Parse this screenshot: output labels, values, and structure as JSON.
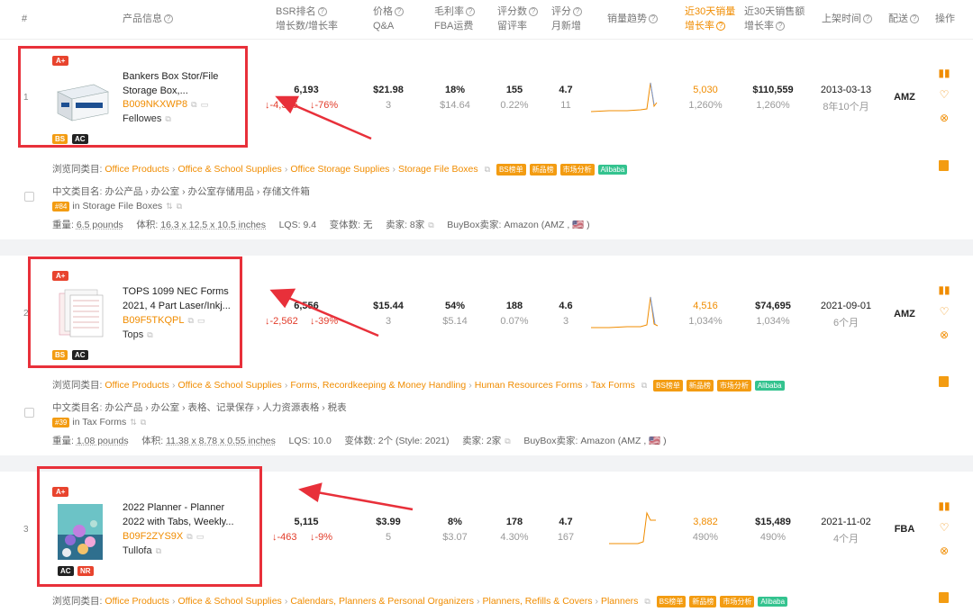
{
  "header": {
    "index": "#",
    "product_info": "产品信息",
    "bsr_rank": "BSR排名",
    "bsr_growth": "增长数/增长率",
    "price": "价格",
    "qa": "Q&A",
    "margin": "毛利率",
    "fba_fee": "FBA运费",
    "rating_count": "评分数",
    "review_rate": "留评率",
    "rating": "评分",
    "monthly_new": "月新增",
    "sales_trend": "销量趋势",
    "sales30": "近30天销量",
    "sales30_growth": "增长率",
    "revenue30": "近30天销售额",
    "revenue30_growth": "增长率",
    "listed": "上架时间",
    "shipping": "配送",
    "actions": "操作"
  },
  "products": [
    {
      "index": "1",
      "aplus": "A+",
      "title": "Bankers Box Stor/File Storage Box,...",
      "asin": "B009NKXWP8",
      "brand": "Fellowes",
      "badges": [
        "BS",
        "AC"
      ],
      "bsr": "6,193",
      "bsr_change": "↓-4,325",
      "bsr_change_rate": "↓-76%",
      "price": "$21.98",
      "qa": "3",
      "margin": "18%",
      "fba_fee": "$14.64",
      "rating_count": "155",
      "review_rate": "0.22%",
      "rating": "4.7",
      "monthly_new": "11",
      "sales30": "5,030",
      "sales30_growth": "1,260%",
      "revenue30": "$110,559",
      "revenue30_growth": "1,260%",
      "listed_date": "2013-03-13",
      "listed_ago": "8年10个月",
      "shipping": "AMZ",
      "category_label": "浏览同类目:",
      "crumbs": [
        "Office Products",
        "Office & School Supplies",
        "Office Storage Supplies",
        "Storage File Boxes"
      ],
      "tags": [
        "BS榜单",
        "新品榜",
        "市场分析",
        "Alibaba"
      ],
      "cn_category": "中文类目名: 办公产品 › 办公室 › 办公室存储用品 › 存储文件箱",
      "rank_badge": "#84",
      "rank_text": "in Storage File Boxes",
      "weight_label": "重量:",
      "weight": "6.5 pounds",
      "volume_label": "体积:",
      "volume": "16.3 x 12.5 x 10.5 inches",
      "lqs": "LQS: 9.4",
      "variants": "变体数: 无",
      "sellers": "卖家: 8家",
      "buybox": "BuyBox卖家: Amazon (AMZ , 🇺🇸 )"
    },
    {
      "index": "2",
      "aplus": "A+",
      "title": "TOPS 1099 NEC Forms 2021, 4 Part Laser/Inkj...",
      "asin": "B09F5TKQPL",
      "brand": "Tops",
      "badges": [
        "BS",
        "AC"
      ],
      "bsr": "6,556",
      "bsr_change": "↓-2,562",
      "bsr_change_rate": "↓-39%",
      "price": "$15.44",
      "qa": "3",
      "margin": "54%",
      "fba_fee": "$5.14",
      "rating_count": "188",
      "review_rate": "0.07%",
      "rating": "4.6",
      "monthly_new": "3",
      "sales30": "4,516",
      "sales30_growth": "1,034%",
      "revenue30": "$74,695",
      "revenue30_growth": "1,034%",
      "listed_date": "2021-09-01",
      "listed_ago": "6个月",
      "shipping": "AMZ",
      "category_label": "浏览同类目:",
      "crumbs": [
        "Office Products",
        "Office & School Supplies",
        "Forms, Recordkeeping & Money Handling",
        "Human Resources Forms",
        "Tax Forms"
      ],
      "tags": [
        "BS榜单",
        "新品榜",
        "市场分析",
        "Alibaba"
      ],
      "cn_category": "中文类目名: 办公产品 › 办公室 › 表格、记录保存 › 人力资源表格 › 税表",
      "rank_badge": "#39",
      "rank_text": "in Tax Forms",
      "weight_label": "重量:",
      "weight": "1.08 pounds",
      "volume_label": "体积:",
      "volume": "11.38 x 8.78 x 0.55 inches",
      "lqs": "LQS: 10.0",
      "variants": "变体数: 2个 (Style: 2021)",
      "sellers": "卖家: 2家",
      "buybox": "BuyBox卖家: Amazon (AMZ , 🇺🇸 )"
    },
    {
      "index": "3",
      "aplus": "A+",
      "title": "2022 Planner - Planner 2022 with Tabs, Weekly...",
      "asin": "B09F2ZYS9X",
      "brand": "Tullofa",
      "badges": [
        "AC",
        "NR"
      ],
      "bsr": "5,115",
      "bsr_change": "↓-463",
      "bsr_change_rate": "↓-9%",
      "price": "$3.99",
      "qa": "5",
      "margin": "8%",
      "fba_fee": "$3.07",
      "rating_count": "178",
      "review_rate": "4.30%",
      "rating": "4.7",
      "monthly_new": "167",
      "sales30": "3,882",
      "sales30_growth": "490%",
      "revenue30": "$15,489",
      "revenue30_growth": "490%",
      "listed_date": "2021-11-02",
      "listed_ago": "4个月",
      "shipping": "FBA",
      "category_label": "浏览同类目:",
      "crumbs": [
        "Office Products",
        "Office & School Supplies",
        "Calendars, Planners & Personal Organizers",
        "Planners, Refills & Covers",
        "Planners"
      ],
      "tags": [
        "BS榜单",
        "新品榜",
        "市场分析",
        "Alibaba"
      ]
    }
  ]
}
